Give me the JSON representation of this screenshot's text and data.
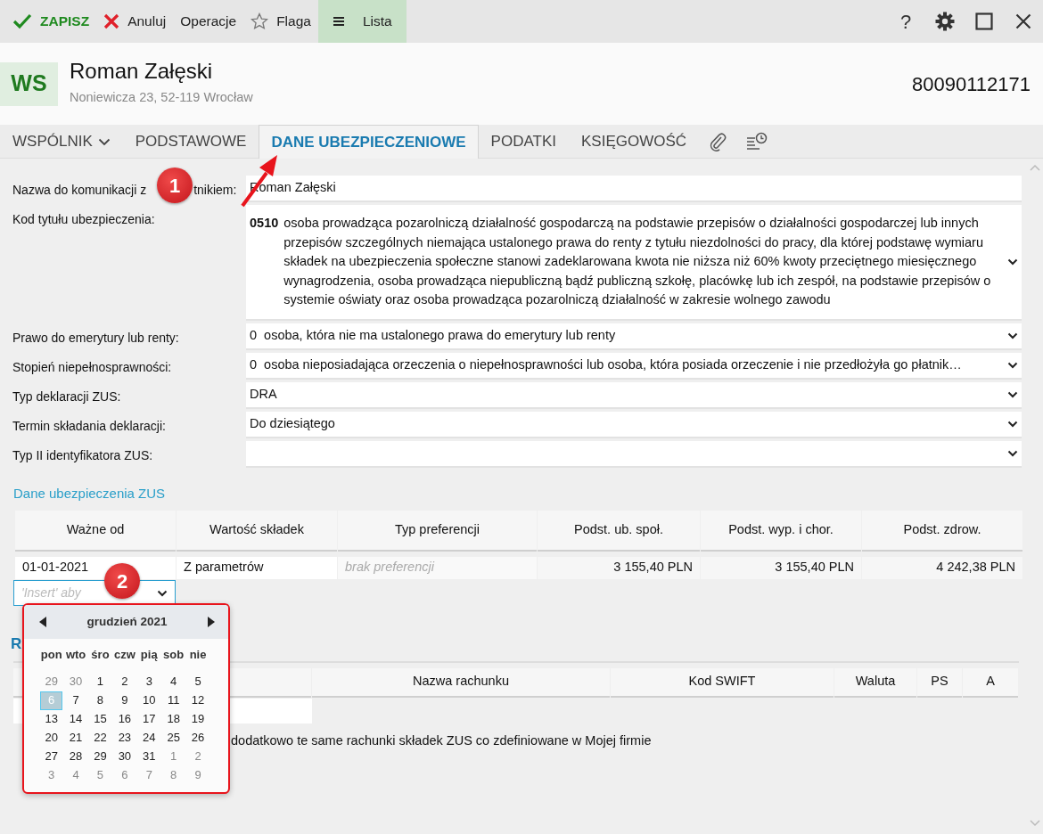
{
  "toolbar": {
    "buttons": [
      {
        "label": "ZAPISZ",
        "kind": "save",
        "selected": false
      },
      {
        "label": "Anuluj",
        "kind": "cancel",
        "selected": false
      },
      {
        "label": "Operacje",
        "kind": "plain",
        "selected": false
      },
      {
        "label": "Flaga",
        "kind": "flag",
        "selected": false
      },
      {
        "label": "Lista",
        "kind": "list",
        "selected": true
      }
    ],
    "window_controls": [
      {
        "kind": "help",
        "label": "?"
      },
      {
        "kind": "settings"
      },
      {
        "kind": "maximize"
      },
      {
        "kind": "close"
      }
    ]
  },
  "header": {
    "initials": "WS",
    "name": "Roman Załęski",
    "address": "Noniewicza 23, 52-119 Wrocław",
    "number": "80090112171"
  },
  "tabs": [
    {
      "label": "WSPÓLNIK",
      "kind": "dropdown",
      "selected": false
    },
    {
      "label": "PODSTAWOWE",
      "kind": "text",
      "selected": false
    },
    {
      "label": "DANE UBEZPIECZENIOWE",
      "kind": "text",
      "selected": true
    },
    {
      "label": "PODATKI",
      "kind": "text",
      "selected": false
    },
    {
      "label": "KSIĘGOWOŚĆ",
      "kind": "text",
      "selected": false
    },
    {
      "kind": "attachments",
      "selected": false
    },
    {
      "kind": "history",
      "selected": false
    }
  ],
  "form": [
    {
      "label_parts": [
        "Nazwa do komunikacji z",
        "tnikiem:"
      ],
      "kind": "text",
      "value": "Roman Załęski"
    },
    {
      "label": "Kod tytułu ubezpieczenia:",
      "kind": "select",
      "code": "0510",
      "value": "osoba prowadząca pozarolniczą działalność gospodarczą na podstawie przepisów o działalności gospodarczej lub innych przepisów szczególnych niemająca ustalonego prawa do renty z tytułu niezdolności do pracy, dla której podstawę wymiaru składek na ubezpieczenia społeczne stanowi zadeklarowana kwota nie niższa niż 60% kwoty przeciętnego miesięcznego wynagrodzenia, osoba prowadząca niepubliczną bądź publiczną szkołę, placówkę lub ich zespół, na podstawie przepisów o systemie oświaty oraz osoba prowadząca pozarolniczą działalność w zakresie wolnego zawodu"
    },
    {
      "label": "Prawo do emerytury lub renty:",
      "kind": "select",
      "prefix": "0",
      "value": "osoba, która nie ma ustalonego prawa do emerytury lub renty"
    },
    {
      "label": "Stopień niepełnosprawności:",
      "kind": "select",
      "prefix": "0",
      "value": "osoba nieposiadająca orzeczenia o niepełnosprawności lub osoba, która posiada orzeczenie i nie przedłożyła go płatnik…"
    },
    {
      "label": "Typ deklaracji ZUS:",
      "kind": "select",
      "value": "DRA"
    },
    {
      "label": "Termin składania deklaracji:",
      "kind": "select",
      "value": "Do dziesiątego"
    },
    {
      "label": "Typ II identyfikatora ZUS:",
      "kind": "select"
    }
  ],
  "zus_section": {
    "title": "Dane ubezpieczenia ZUS",
    "columns": [
      "Ważne od",
      "Wartość składek",
      "Typ preferencji",
      "Podst. ub. społ.",
      "Podst. wyp. i chor.",
      "Podst. zdrow."
    ],
    "rows": [
      {
        "cells": [
          {
            "kind": "text",
            "text": "01-01-2021"
          },
          {
            "kind": "text",
            "text": "Z parametrów"
          },
          {
            "kind": "placeholder",
            "text": "brak preferencji"
          },
          {
            "kind": "amount",
            "text": "3 155,40 PLN"
          },
          {
            "kind": "amount",
            "text": "3 155,40 PLN"
          },
          {
            "kind": "amount",
            "text": "4 242,38 PLN"
          }
        ]
      }
    ],
    "new_row": {
      "placeholder": "'Insert' aby"
    }
  },
  "calendar": {
    "month": "grudzień 2021",
    "outlined": true,
    "weekdays": [
      "pon",
      "wto",
      "śro",
      "czw",
      "pią",
      "sob",
      "nie"
    ],
    "weeks": [
      [
        {
          "label": "29",
          "in_month": false,
          "selected": false
        },
        {
          "label": "30",
          "in_month": false,
          "selected": false
        },
        {
          "label": "1",
          "in_month": true,
          "selected": false
        },
        {
          "label": "2",
          "in_month": true,
          "selected": false
        },
        {
          "label": "3",
          "in_month": true,
          "selected": false
        },
        {
          "label": "4",
          "in_month": true,
          "selected": false
        },
        {
          "label": "5",
          "in_month": true,
          "selected": false
        }
      ],
      [
        {
          "label": "6",
          "in_month": true,
          "selected": true
        },
        {
          "label": "7",
          "in_month": true,
          "selected": false
        },
        {
          "label": "8",
          "in_month": true,
          "selected": false
        },
        {
          "label": "9",
          "in_month": true,
          "selected": false
        },
        {
          "label": "10",
          "in_month": true,
          "selected": false
        },
        {
          "label": "11",
          "in_month": true,
          "selected": false
        },
        {
          "label": "12",
          "in_month": true,
          "selected": false
        }
      ],
      [
        {
          "label": "13",
          "in_month": true,
          "selected": false
        },
        {
          "label": "14",
          "in_month": true,
          "selected": false
        },
        {
          "label": "15",
          "in_month": true,
          "selected": false
        },
        {
          "label": "16",
          "in_month": true,
          "selected": false
        },
        {
          "label": "17",
          "in_month": true,
          "selected": false
        },
        {
          "label": "18",
          "in_month": true,
          "selected": false
        },
        {
          "label": "19",
          "in_month": true,
          "selected": false
        }
      ],
      [
        {
          "label": "20",
          "in_month": true,
          "selected": false
        },
        {
          "label": "21",
          "in_month": true,
          "selected": false
        },
        {
          "label": "22",
          "in_month": true,
          "selected": false
        },
        {
          "label": "23",
          "in_month": true,
          "selected": false
        },
        {
          "label": "24",
          "in_month": true,
          "selected": false
        },
        {
          "label": "25",
          "in_month": true,
          "selected": false
        },
        {
          "label": "26",
          "in_month": true,
          "selected": false
        }
      ],
      [
        {
          "label": "27",
          "in_month": true,
          "selected": false
        },
        {
          "label": "28",
          "in_month": true,
          "selected": false
        },
        {
          "label": "29",
          "in_month": true,
          "selected": false
        },
        {
          "label": "30",
          "in_month": true,
          "selected": false
        },
        {
          "label": "31",
          "in_month": true,
          "selected": false
        },
        {
          "label": "1",
          "in_month": false,
          "selected": false
        },
        {
          "label": "2",
          "in_month": false,
          "selected": false
        }
      ],
      [
        {
          "label": "3",
          "in_month": false,
          "selected": false
        },
        {
          "label": "4",
          "in_month": false,
          "selected": false
        },
        {
          "label": "5",
          "in_month": false,
          "selected": false
        },
        {
          "label": "6",
          "in_month": false,
          "selected": false
        },
        {
          "label": "7",
          "in_month": false,
          "selected": false
        },
        {
          "label": "8",
          "in_month": false,
          "selected": false
        },
        {
          "label": "9",
          "in_month": false,
          "selected": false
        }
      ]
    ]
  },
  "accounts_section": {
    "title": "R",
    "columns": [
      "Nazwa rachunku",
      "Kod SWIFT",
      "Waluta",
      "PS",
      "A"
    ],
    "note": "dodatkowo te same rachunki składek ZUS co zdefiniowane w Mojej firmie"
  },
  "annotations": {
    "badges": [
      {
        "label": "1"
      },
      {
        "label": "2"
      }
    ]
  }
}
